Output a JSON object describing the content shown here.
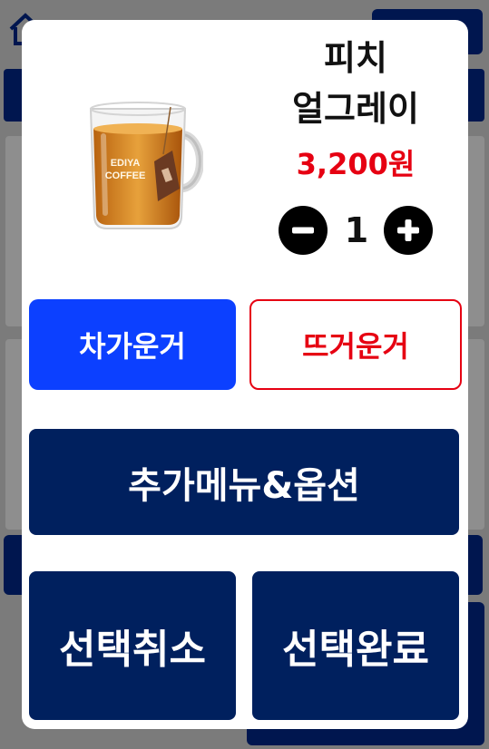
{
  "product": {
    "name_line1": "피치",
    "name_line2": "얼그레이",
    "price": "3,200원",
    "image_icon": "tea-glass-mug-icon",
    "image_brand_text": [
      "EDIYA",
      "COFFEE"
    ]
  },
  "quantity": {
    "value": "1",
    "minus_icon": "minus-circle-icon",
    "plus_icon": "plus-circle-icon"
  },
  "temperature": {
    "iced_label": "차가운거",
    "hot_label": "뜨거운거",
    "selected": "iced"
  },
  "actions": {
    "options_label": "추가메뉴&옵션",
    "cancel_label": "선택취소",
    "confirm_label": "선택완료"
  },
  "colors": {
    "navy": "#00205e",
    "blue_selected": "#0c40ff",
    "red": "#e60012",
    "overlay": "#7b7b7b"
  }
}
